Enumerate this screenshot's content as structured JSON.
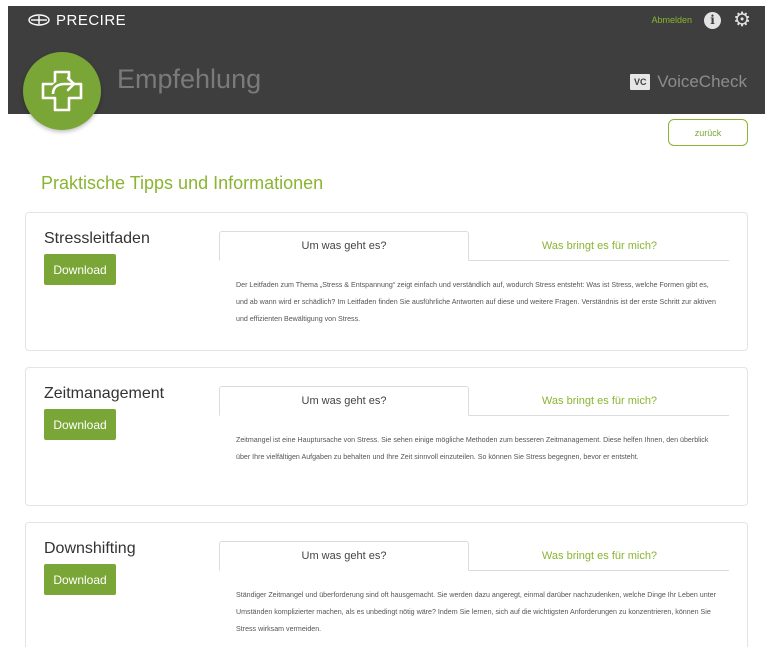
{
  "header": {
    "brand": "PRECIRE",
    "logout": "Abmelden",
    "page_title": "Empfehlung",
    "product": "VoiceCheck",
    "product_badge": "VC"
  },
  "actions": {
    "back": "zurück"
  },
  "section_title": "Praktische Tipps und Informationen",
  "cards": [
    {
      "title": "Stressleitfaden",
      "download": "Download",
      "tab_active": "Um was geht es?",
      "tab_other": "Was bringt es für mich?",
      "text": "Der Leitfaden zum Thema „Stress & Entspannung“ zeigt einfach und verständlich auf, wodurch Stress entsteht: Was ist Stress, welche Formen gibt es, und ab wann wird er schädlich? Im Leitfaden finden Sie ausführliche Antworten auf diese und weitere Fragen. Verständnis ist der erste Schritt zur aktiven und effizienten Bewältigung von Stress."
    },
    {
      "title": "Zeitmanagement",
      "download": "Download",
      "tab_active": "Um was geht es?",
      "tab_other": "Was bringt es für mich?",
      "text": "Zeitmangel ist eine Hauptursache von Stress. Sie sehen einige mögliche Methoden zum besseren Zeitmanagement. Diese helfen Ihnen, den überblick über Ihre vielfältigen Aufgaben zu behalten und Ihre Zeit sinnvoll einzuteilen. So können Sie Stress begegnen, bevor er entsteht."
    },
    {
      "title": "Downshifting",
      "download": "Download",
      "tab_active": "Um was geht es?",
      "tab_other": "Was bringt es für mich?",
      "text": "Ständiger Zeitmangel und überforderung sind oft hausgemacht. Sie werden dazu angeregt, einmal darüber nachzudenken, welche Dinge Ihr Leben unter Umständen komplizierter machen, als es unbedingt nötig wäre? Indem Sie lernen, sich auf die wichtigsten Anforderungen zu konzentrieren, können Sie Stress wirksam vermeiden."
    }
  ]
}
